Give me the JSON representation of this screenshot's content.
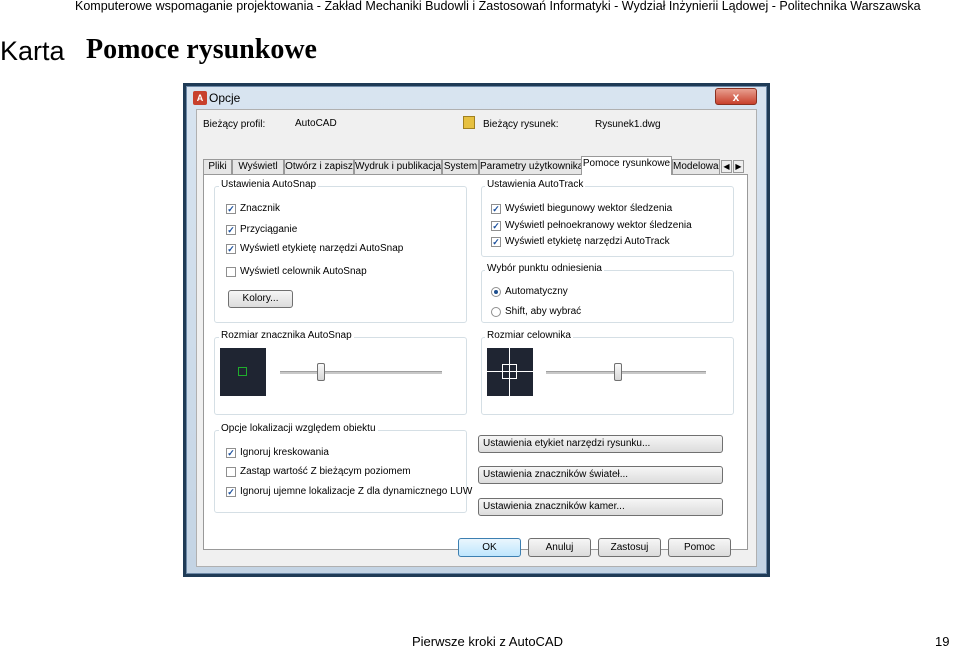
{
  "page": {
    "header": "Komputerowe wspomaganie projektowania - Zakład Mechaniki Budowli i Zastosowań Informatyki - Wydział Inżynierii Lądowej - Politechnika Warszawska",
    "karta": "Karta",
    "title": "Pomoce rysunkowe",
    "footer": "Pierwsze kroki z AutoCAD",
    "page_number": "19"
  },
  "dialog": {
    "title": "Opcje",
    "close": "x",
    "profile_label": "Bieżący profil:",
    "profile_value": "AutoCAD",
    "drawing_label": "Bieżący rysunek:",
    "drawing_value": "Rysunek1.dwg",
    "tabs": [
      "Pliki",
      "Wyświetl",
      "Otwórz i zapisz",
      "Wydruk i publikacja",
      "System",
      "Parametry użytkownika",
      "Pomoce rysunkowe",
      "Modelowan"
    ],
    "active_tab": "Pomoce rysunkowe",
    "autosnap": {
      "title": "Ustawienia AutoSnap",
      "items": [
        {
          "label": "Znacznik",
          "checked": true
        },
        {
          "label": "Przyciąganie",
          "checked": true
        },
        {
          "label": "Wyświetl etykietę narzędzi AutoSnap",
          "checked": true
        },
        {
          "label": "Wyświetl celownik AutoSnap",
          "checked": false
        }
      ],
      "colors_button": "Kolory..."
    },
    "autotrack": {
      "title": "Ustawienia AutoTrack",
      "items": [
        {
          "label": "Wyświetl biegunowy wektor śledzenia",
          "checked": true
        },
        {
          "label": "Wyświetl pełnoekranowy wektor śledzenia",
          "checked": true
        },
        {
          "label": "Wyświetl etykietę narzędzi AutoTrack",
          "checked": true
        }
      ]
    },
    "reference": {
      "title": "Wybór punktu odniesienia",
      "options": [
        {
          "label": "Automatyczny",
          "selected": true
        },
        {
          "label": "Shift, aby wybrać",
          "selected": false
        }
      ]
    },
    "marker_size": {
      "title": "Rozmiar znacznika AutoSnap",
      "level": 0.25,
      "marker_color": "#1fae2c"
    },
    "aperture_size": {
      "title": "Rozmiar celownika",
      "level": 0.45
    },
    "location": {
      "title": "Opcje lokalizacji względem obiektu",
      "items": [
        {
          "label": "Ignoruj kreskowania",
          "checked": true
        },
        {
          "label": "Zastąp wartość Z bieżącym poziomem",
          "checked": false
        },
        {
          "label": "Ignoruj ujemne lokalizacje Z dla dynamicznego LUW",
          "checked": true
        }
      ]
    },
    "right_buttons": [
      "Ustawienia etykiet narzędzi rysunku...",
      "Ustawienia znaczników świateł...",
      "Ustawienia znaczników kamer..."
    ],
    "footer_buttons": [
      "OK",
      "Anuluj",
      "Zastosuj",
      "Pomoc"
    ]
  }
}
